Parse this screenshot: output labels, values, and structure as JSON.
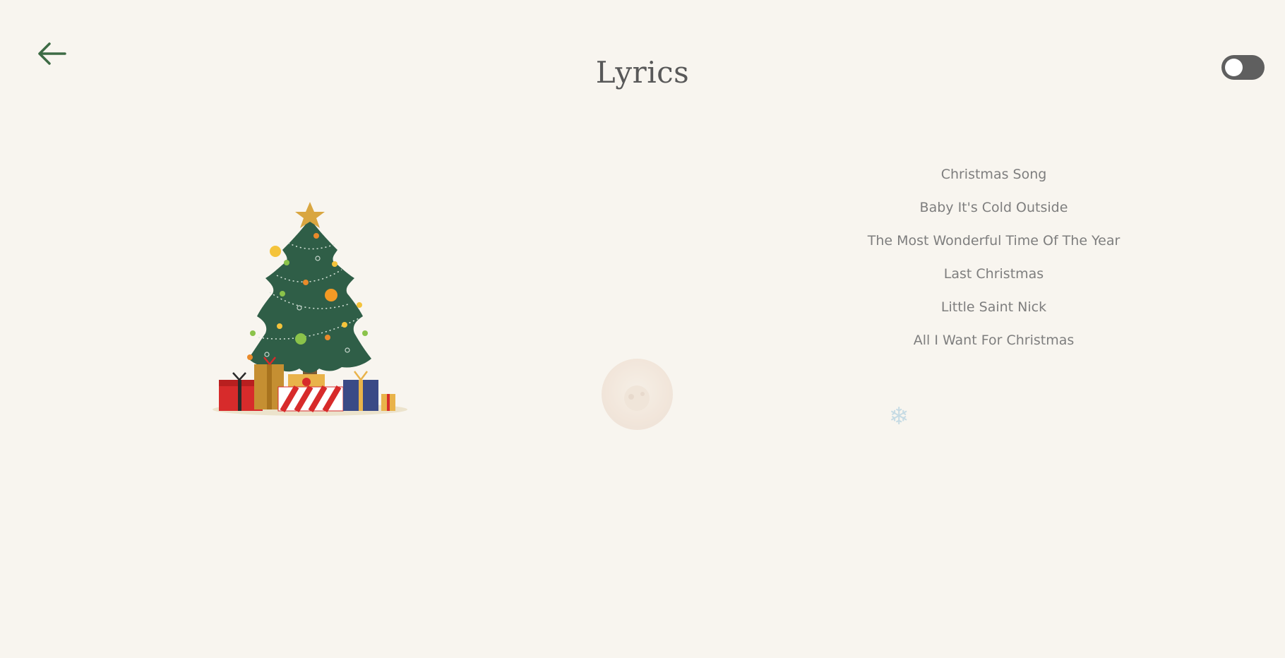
{
  "header": {
    "title": "Lyrics",
    "back_icon": "arrow-left-icon",
    "theme_toggle_state": "off"
  },
  "illustration": {
    "icon": "christmas-tree-with-gifts"
  },
  "decorations": {
    "ornament_icon": "ornament-icon",
    "snowflake_icon": "snowflake-icon"
  },
  "songs": [
    {
      "label": "Christmas Song"
    },
    {
      "label": "Baby It's Cold Outside"
    },
    {
      "label": "The Most Wonderful Time Of The Year"
    },
    {
      "label": "Last Christmas"
    },
    {
      "label": "Little Saint Nick"
    },
    {
      "label": "All I Want For Christmas"
    }
  ],
  "colors": {
    "background": "#f8f5ef",
    "accent_green": "#3d6b45",
    "title": "#585858",
    "song_text": "#7e7e7e",
    "toggle": "#5f5f5f"
  }
}
